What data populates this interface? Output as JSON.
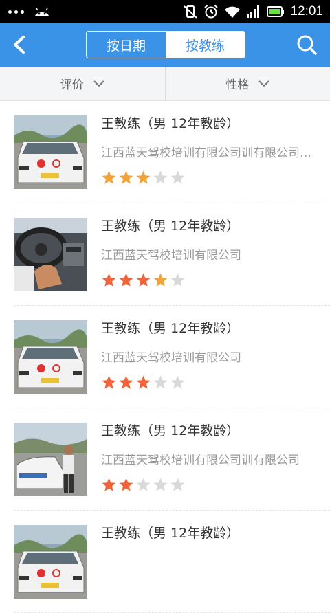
{
  "status_bar": {
    "time": "12:01"
  },
  "nav": {
    "tabs": [
      {
        "label": "按日期",
        "active": false
      },
      {
        "label": "按教练",
        "active": true
      }
    ]
  },
  "filters": [
    {
      "label": "评价"
    },
    {
      "label": "性格"
    }
  ],
  "coaches": [
    {
      "name": "王教练（男  12年教龄）",
      "school": "江西蓝天驾校培训有限公司训有限公司训有限公司",
      "rating": 3,
      "photo": "car"
    },
    {
      "name": "王教练（男  12年教龄）",
      "school": "江西蓝天驾校培训有限公司",
      "rating": 4,
      "photo": "wheel"
    },
    {
      "name": "王教练（男  12年教龄）",
      "school": "江西蓝天驾校培训有限公司",
      "rating": 3,
      "photo": "car"
    },
    {
      "name": "王教练（男  12年教龄）",
      "school": "江西蓝天驾校培训有限公司训有限公司",
      "rating": 2,
      "photo": "person"
    },
    {
      "name": "王教练（男  12年教龄）",
      "school": "",
      "rating": 0,
      "photo": "car"
    }
  ],
  "colors": {
    "primary": "#3b93e8",
    "star_red": "#f0633b",
    "star_orange": "#f2a33a",
    "star_empty": "#d9d9d9"
  }
}
